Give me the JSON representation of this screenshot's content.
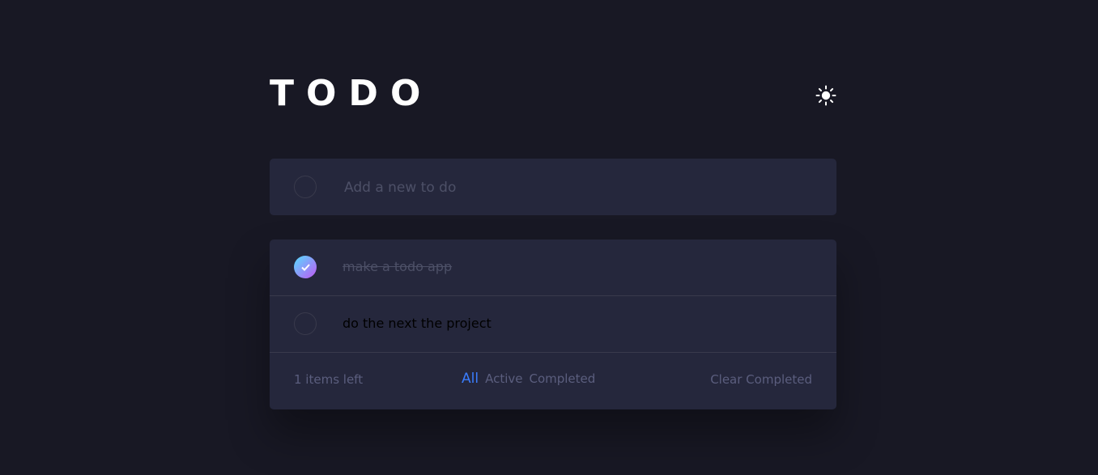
{
  "header": {
    "title": "TODO",
    "theme_icon": "sun-icon"
  },
  "new_todo": {
    "placeholder": "Add a new to do",
    "value": ""
  },
  "todos": [
    {
      "text": "make a todo app",
      "completed": true
    },
    {
      "text": "do the next the project",
      "completed": false
    }
  ],
  "footer": {
    "items_left": "1 items left",
    "filters": [
      "All",
      "Active",
      "Completed"
    ],
    "selected_filter": "All",
    "clear_label": "Clear Completed"
  },
  "colors": {
    "background": "#181824",
    "card": "#25273c",
    "accent": "#3a7cfd",
    "check_gradient_start": "#55ddff",
    "check_gradient_end": "#c058f3",
    "muted_text": "#5b5e7e"
  }
}
